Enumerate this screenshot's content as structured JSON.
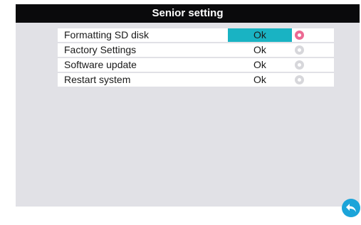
{
  "header": {
    "title": "Senior setting"
  },
  "rows": [
    {
      "label": "Formatting SD disk",
      "button": "Ok",
      "selected": true
    },
    {
      "label": "Factory Settings",
      "button": "Ok",
      "selected": false
    },
    {
      "label": "Software update",
      "button": "Ok",
      "selected": false
    },
    {
      "label": "Restart system",
      "button": "Ok",
      "selected": false
    }
  ],
  "colors": {
    "title_bar": "#0a0a0c",
    "background": "#e1e1e6",
    "row_background": "#ffffff",
    "selected_button": "#19b3c3",
    "active_indicator": "#ec6a93",
    "inactive_indicator": "#d7d7db",
    "back_button": "#1ba4d9"
  },
  "icons": {
    "row_indicator": "gear-icon",
    "back": "back-arrow-icon"
  }
}
